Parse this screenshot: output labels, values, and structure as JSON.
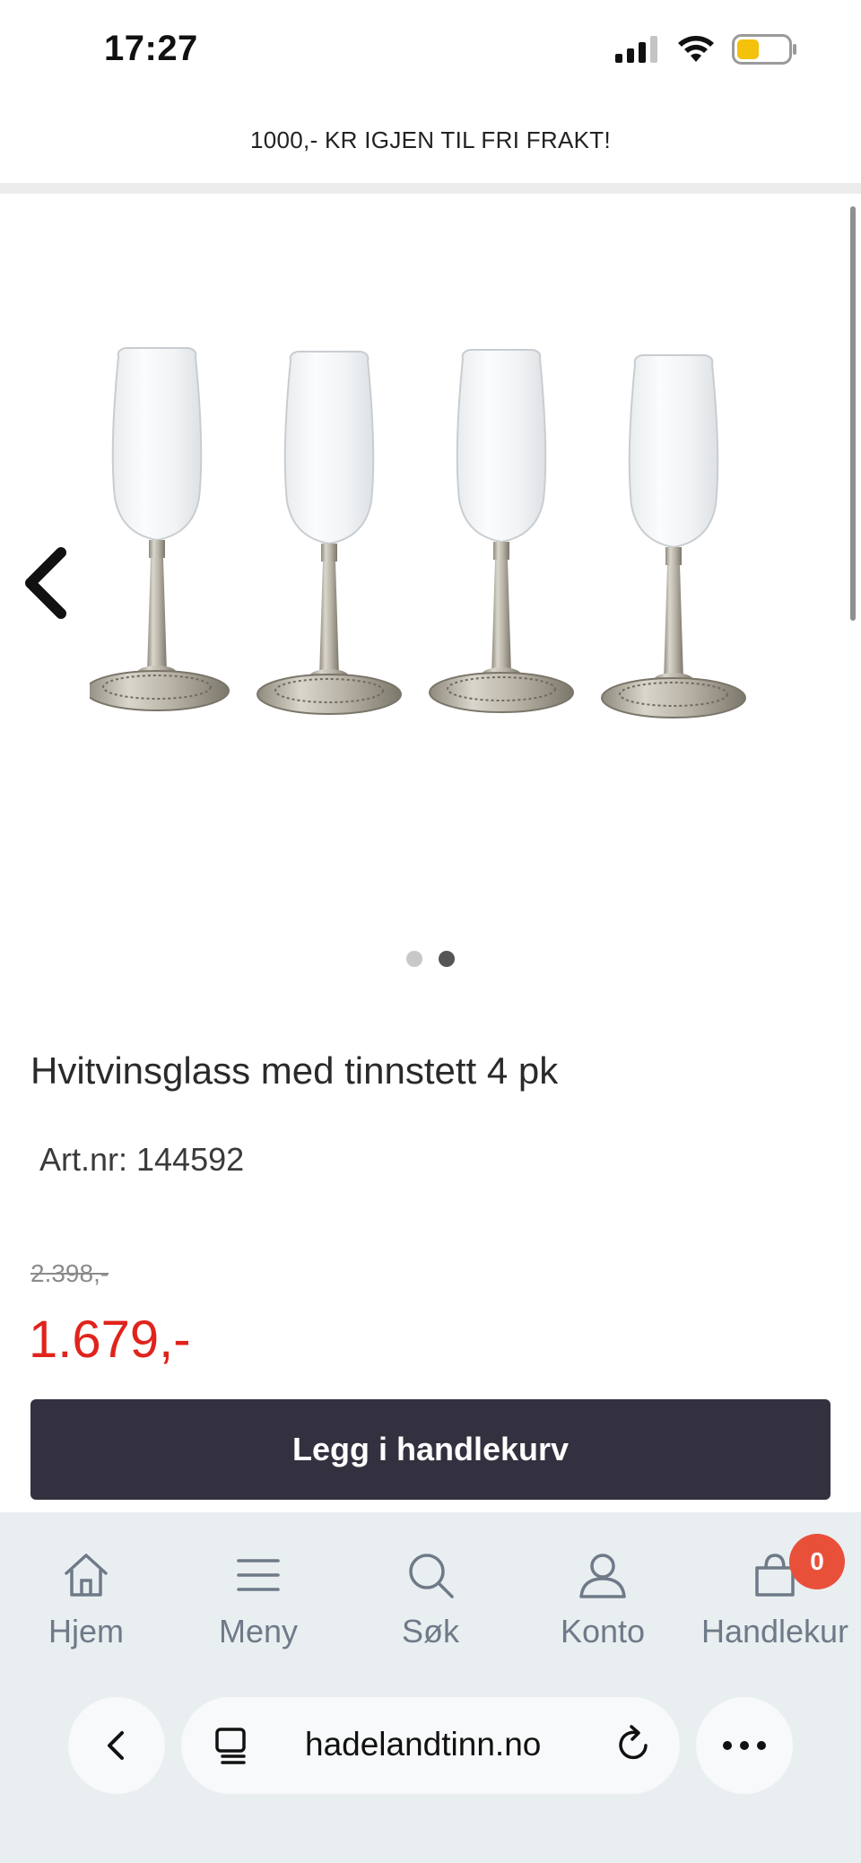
{
  "status_bar": {
    "time": "17:27",
    "battery_color": "#f4c20d"
  },
  "banner": {
    "text": "1000,- KR IGJEN TIL FRI FRAKT!"
  },
  "gallery": {
    "total_images": 2,
    "active_index": 1
  },
  "product": {
    "title": "Hvitvinsglass med tinnstett 4 pk",
    "art_nr": "Art.nr: 144592",
    "old_price": "2.398,-",
    "new_price": "1.679,-",
    "add_to_cart_label": "Legg i handlekurv",
    "price_color": "#e0231c"
  },
  "bottom_nav": {
    "items": [
      {
        "label": "Hjem",
        "icon": "home-icon"
      },
      {
        "label": "Meny",
        "icon": "menu-icon"
      },
      {
        "label": "Søk",
        "icon": "search-icon"
      },
      {
        "label": "Konto",
        "icon": "account-icon"
      },
      {
        "label": "Handlekurv",
        "icon": "cart-icon"
      }
    ],
    "cart_count": "0"
  },
  "browser": {
    "url": "hadelandtinn.no"
  }
}
